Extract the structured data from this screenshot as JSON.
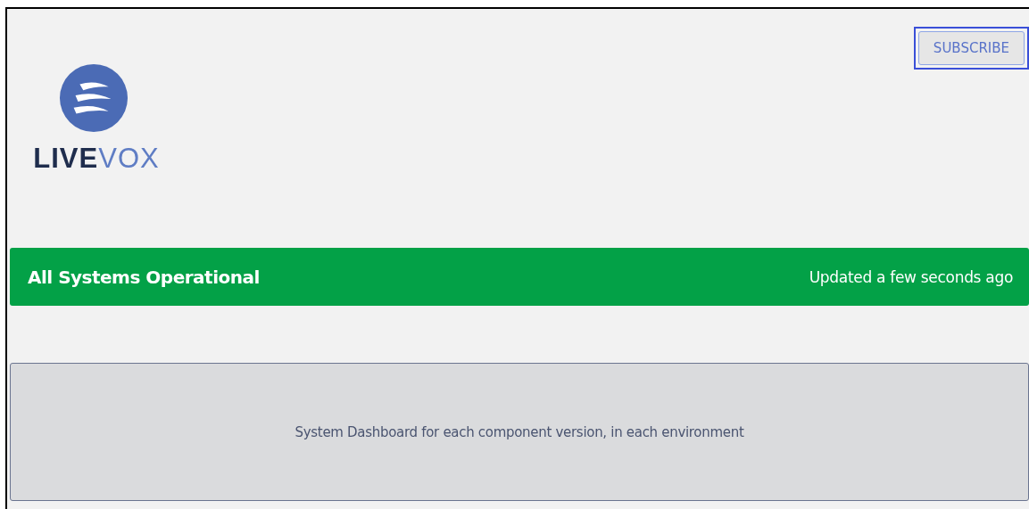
{
  "header": {
    "logo": {
      "dark_part": "LIVE",
      "light_part": "VOX"
    },
    "subscribe_button": {
      "label": "SUBSCRIBE",
      "focused": true
    }
  },
  "status_banner": {
    "kind": "operational",
    "title": "All Systems Operational",
    "updated": "Updated a few seconds ago"
  },
  "info_card": {
    "text": "System Dashboard for each component version, in each environment"
  }
}
